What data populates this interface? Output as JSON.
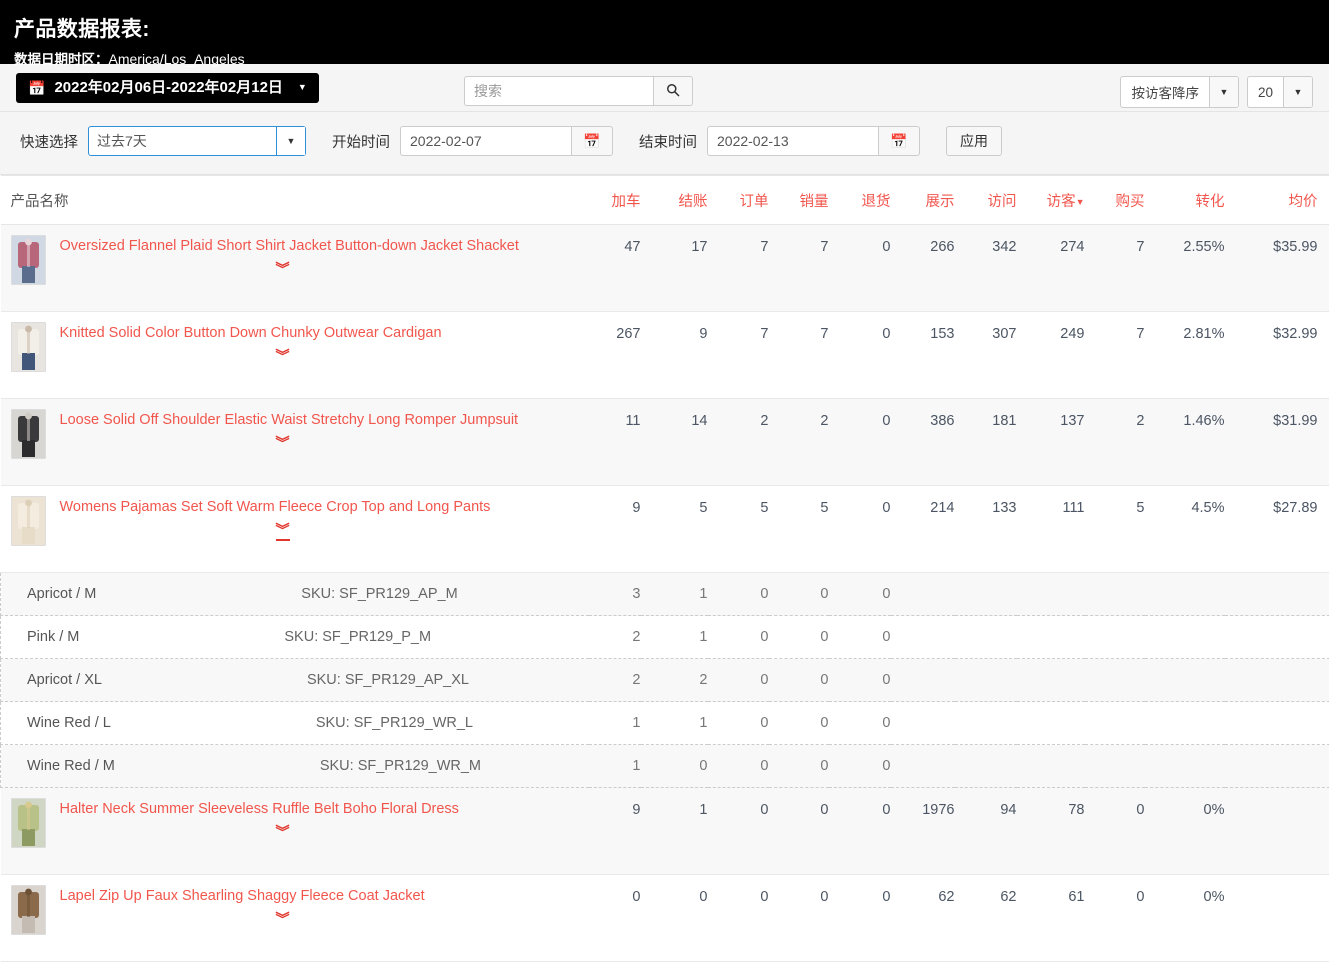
{
  "header": {
    "title": "产品数据报表:",
    "timezone_label": "数据日期时区：",
    "timezone_value": "America/Los_Angeles"
  },
  "toolbar": {
    "date_range_label": "2022年02月06日-2022年02月12日",
    "calendar_icon": "calendar-icon",
    "caret_icon": "caret-down-icon",
    "search_placeholder": "搜索",
    "search_value": "",
    "search_icon": "search-icon",
    "sort_value": "按访客降序",
    "page_size_value": "20",
    "quick_select_label": "快速选择",
    "quick_select_value": "过去7天",
    "start_label": "开始时间",
    "start_value": "2022-02-07",
    "end_label": "结束时间",
    "end_value": "2022-02-13",
    "apply_label": "应用"
  },
  "table": {
    "columns": [
      {
        "key": "name",
        "label": "产品名称"
      },
      {
        "key": "cart",
        "label": "加车"
      },
      {
        "key": "checkout",
        "label": "结账"
      },
      {
        "key": "orders",
        "label": "订单"
      },
      {
        "key": "sales",
        "label": "销量"
      },
      {
        "key": "returns",
        "label": "退货"
      },
      {
        "key": "impressions",
        "label": "展示"
      },
      {
        "key": "visits",
        "label": "访问"
      },
      {
        "key": "visitors",
        "label": "访客"
      },
      {
        "key": "purchases",
        "label": "购买"
      },
      {
        "key": "conversion",
        "label": "转化"
      },
      {
        "key": "avg_price",
        "label": "均价"
      }
    ],
    "sorted_column": "访客",
    "sort_direction_icon": "caret-down-icon",
    "rows": [
      {
        "name": "Oversized Flannel Plaid Short Shirt Jacket Button-down Jacket Shacket",
        "thumb": "product-thumbnail-plaid-shirt-jacket",
        "expanded": false,
        "cart": "47",
        "checkout": "17",
        "orders": "7",
        "sales": "7",
        "returns": "0",
        "impressions": "266",
        "visits": "342",
        "visitors": "274",
        "purchases": "7",
        "conversion": "2.55%",
        "avg_price": "$35.99",
        "variants": []
      },
      {
        "name": "Knitted Solid Color Button Down Chunky Outwear Cardigan",
        "thumb": "product-thumbnail-knitted-cardigan",
        "expanded": false,
        "cart": "267",
        "checkout": "9",
        "orders": "7",
        "sales": "7",
        "returns": "0",
        "impressions": "153",
        "visits": "307",
        "visitors": "249",
        "purchases": "7",
        "conversion": "2.81%",
        "avg_price": "$32.99",
        "variants": []
      },
      {
        "name": "Loose Solid Off Shoulder Elastic Waist Stretchy Long Romper Jumpsuit",
        "thumb": "product-thumbnail-romper-jumpsuit",
        "expanded": false,
        "cart": "11",
        "checkout": "14",
        "orders": "2",
        "sales": "2",
        "returns": "0",
        "impressions": "386",
        "visits": "181",
        "visitors": "137",
        "purchases": "2",
        "conversion": "1.46%",
        "avg_price": "$31.99",
        "variants": []
      },
      {
        "name": "Womens Pajamas Set Soft Warm Fleece Crop Top and Long Pants",
        "thumb": "product-thumbnail-pajamas-set",
        "expanded": true,
        "cart": "9",
        "checkout": "5",
        "orders": "5",
        "sales": "5",
        "returns": "0",
        "impressions": "214",
        "visits": "133",
        "visitors": "111",
        "purchases": "5",
        "conversion": "4.5%",
        "avg_price": "$27.89",
        "variants": [
          {
            "name": "Apricot / M",
            "sku": "SKU: SF_PR129_AP_M",
            "cart": "3",
            "checkout": "1",
            "orders": "0",
            "sales": "0",
            "returns": "0"
          },
          {
            "name": "Pink / M",
            "sku": "SKU: SF_PR129_P_M",
            "cart": "2",
            "checkout": "1",
            "orders": "0",
            "sales": "0",
            "returns": "0"
          },
          {
            "name": "Apricot / XL",
            "sku": "SKU: SF_PR129_AP_XL",
            "cart": "2",
            "checkout": "2",
            "orders": "0",
            "sales": "0",
            "returns": "0"
          },
          {
            "name": "Wine Red / L",
            "sku": "SKU: SF_PR129_WR_L",
            "cart": "1",
            "checkout": "1",
            "orders": "0",
            "sales": "0",
            "returns": "0"
          },
          {
            "name": "Wine Red / M",
            "sku": "SKU: SF_PR129_WR_M",
            "cart": "1",
            "checkout": "0",
            "orders": "0",
            "sales": "0",
            "returns": "0"
          }
        ]
      },
      {
        "name": "Halter Neck Summer Sleeveless Ruffle Belt Boho Floral Dress",
        "thumb": "product-thumbnail-floral-dress",
        "expanded": false,
        "cart": "9",
        "checkout": "1",
        "orders": "0",
        "sales": "0",
        "returns": "0",
        "impressions": "1976",
        "visits": "94",
        "visitors": "78",
        "purchases": "0",
        "conversion": "0%",
        "avg_price": "",
        "variants": []
      },
      {
        "name": "Lapel Zip Up Faux Shearling Shaggy Fleece Coat Jacket",
        "thumb": "product-thumbnail-shearling-coat",
        "expanded": false,
        "cart": "0",
        "checkout": "0",
        "orders": "0",
        "sales": "0",
        "returns": "0",
        "impressions": "62",
        "visits": "62",
        "visitors": "61",
        "purchases": "0",
        "conversion": "0%",
        "avg_price": "",
        "variants": []
      }
    ]
  },
  "colors": {
    "accent_red": "#f1564d",
    "header_black": "#000000",
    "toolbar_bg": "#f5f5f5",
    "focus_blue": "#2f8fd8"
  }
}
